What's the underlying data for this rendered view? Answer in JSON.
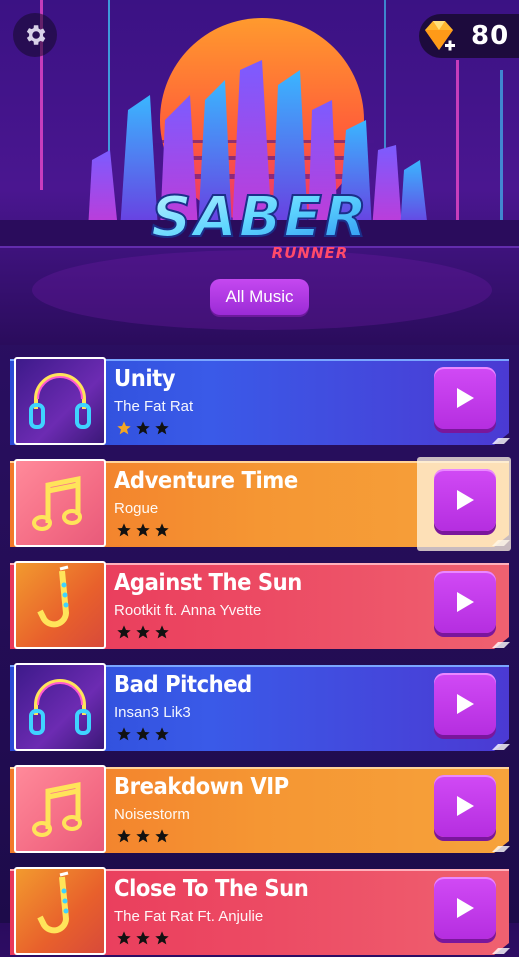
{
  "header": {
    "gem_count": "80",
    "logo_main": "SABER",
    "logo_sub": "RUNNER",
    "filter_button": "All Music"
  },
  "songs": [
    {
      "title": "Unity",
      "artist": "The Fat Rat",
      "stars_filled": 1,
      "stars_total": 3,
      "style": "blue",
      "art": "headphones-icon",
      "highlighted": false
    },
    {
      "title": "Adventure Time",
      "artist": "Rogue",
      "stars_filled": 0,
      "stars_total": 3,
      "style": "orange",
      "art": "music-note-icon",
      "highlighted": true
    },
    {
      "title": "Against The Sun",
      "artist": "Rootkit ft. Anna Yvette",
      "stars_filled": 0,
      "stars_total": 3,
      "style": "red",
      "art": "saxophone-icon",
      "highlighted": false
    },
    {
      "title": "Bad Pitched",
      "artist": "Insan3 Lik3",
      "stars_filled": 0,
      "stars_total": 3,
      "style": "blue",
      "art": "headphones-icon",
      "highlighted": false
    },
    {
      "title": "Breakdown VIP",
      "artist": "Noisestorm",
      "stars_filled": 0,
      "stars_total": 3,
      "style": "orange",
      "art": "music-note-icon",
      "highlighted": false
    },
    {
      "title": "Close To The Sun",
      "artist": "The Fat Rat Ft. Anjulie",
      "stars_filled": 0,
      "stars_total": 3,
      "style": "red",
      "art": "saxophone-icon",
      "highlighted": false
    }
  ],
  "colors": {
    "accent_purple": "#c548f0",
    "star_gold": "#f5a623",
    "star_black": "#111111"
  }
}
